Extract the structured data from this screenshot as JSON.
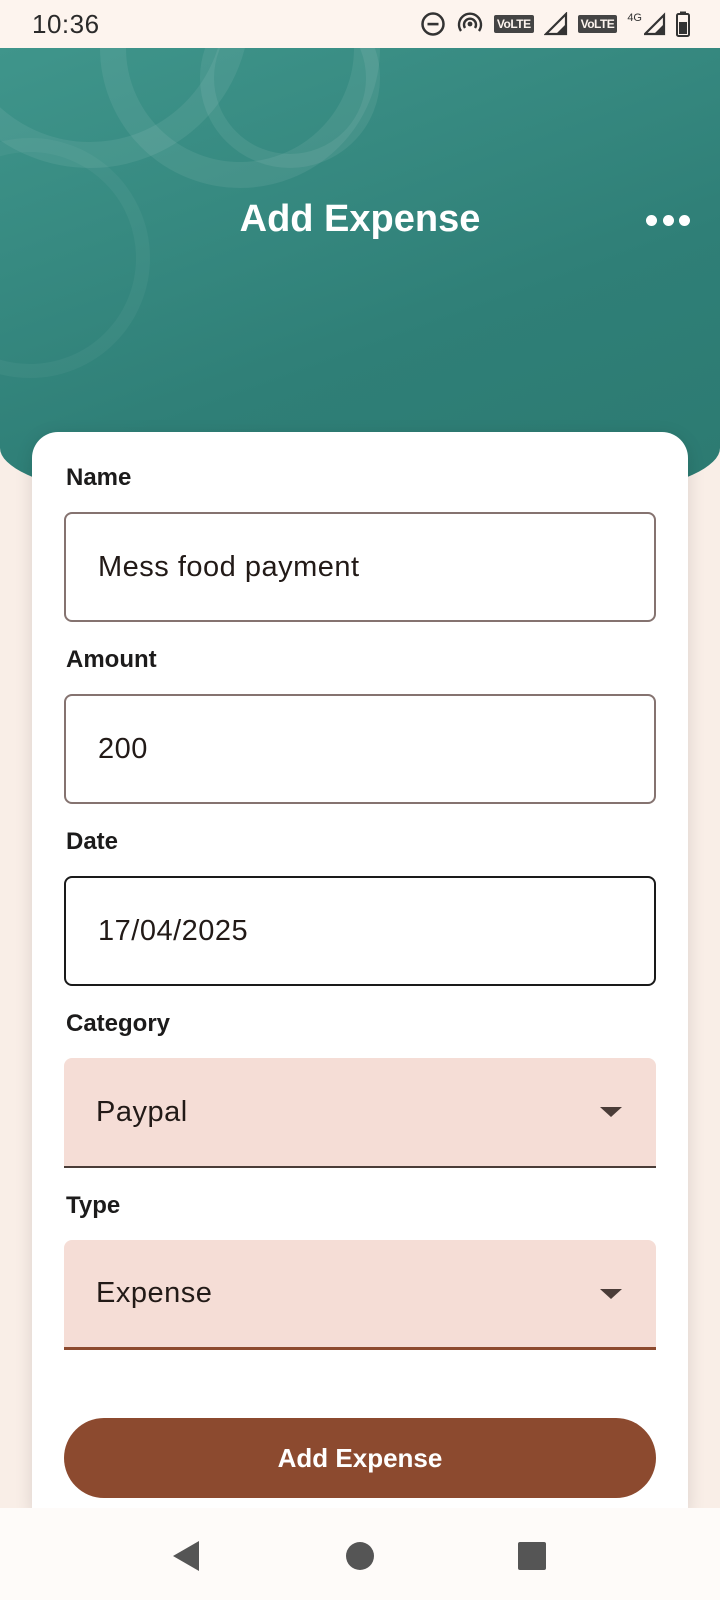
{
  "status_bar": {
    "time": "10:36",
    "volte_1": "VoLTE",
    "volte_2": "VoLTE",
    "network": "4G"
  },
  "header": {
    "title": "Add Expense",
    "menu_icon": "more-horizontal-icon"
  },
  "form": {
    "name": {
      "label": "Name",
      "value": "Mess food payment"
    },
    "amount": {
      "label": "Amount",
      "value": "200"
    },
    "date": {
      "label": "Date",
      "value": "17/04/2025"
    },
    "category": {
      "label": "Category",
      "value": "Paypal"
    },
    "type": {
      "label": "Type",
      "value": "Expense"
    },
    "submit_label": "Add Expense"
  },
  "nav": {
    "back_icon": "back-triangle-icon",
    "home_icon": "home-circle-icon",
    "recents_icon": "recents-square-icon"
  },
  "colors": {
    "header": "#2f7f77",
    "primary_button": "#8c4a2f",
    "select_bg": "#f5ddd6",
    "background": "#f9eee7"
  }
}
